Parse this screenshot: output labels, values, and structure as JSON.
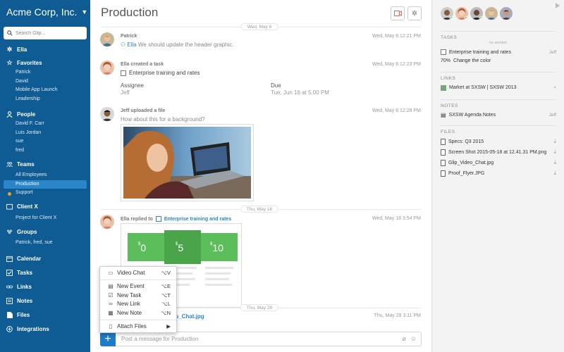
{
  "sidebar": {
    "org_name": "Acme Corp, Inc.",
    "search_placeholder": "Search Glip...",
    "ella": "Ella",
    "favorites": {
      "label": "Favorites",
      "items": [
        "Patrick",
        "David",
        "Mobile App Launch",
        "Leadership"
      ]
    },
    "people": {
      "label": "People",
      "items": [
        "David F. Carr",
        "Luis Jordan",
        "sue",
        "fred"
      ]
    },
    "teams": {
      "label": "Teams",
      "items": [
        "All Employees",
        "Production",
        "Support"
      ]
    },
    "client": {
      "label": "Client X",
      "items": [
        "Project for Client X"
      ]
    },
    "groups": {
      "label": "Groups",
      "items": [
        "Patrick, fred, sue"
      ]
    },
    "calendar": "Calendar",
    "tasks": "Tasks",
    "links": "Links",
    "notes": "Notes",
    "files": "Files",
    "integrations": "Integrations"
  },
  "main": {
    "title": "Production",
    "date_top": "Wed, May 6",
    "msg1": {
      "author": "Patrick",
      "time": "Wed, May 6 12:21 PM",
      "mention": "Ella",
      "text": "We should update the header graphic."
    },
    "msg2": {
      "header": "Ella created a task",
      "time": "Wed, May 6 12:23 PM",
      "task": "Enterprise training and rates",
      "assignee_label": "Assignee",
      "assignee": "Jeff",
      "due_label": "Due",
      "due": "Tue, Jun 16 at 5.00 PM"
    },
    "msg3": {
      "header": "Jeff uploaded a file",
      "time": "Wed, May 6 12:29 PM",
      "text": "How about this for a background?"
    },
    "date_mid": "Thu, May 18",
    "msg4": {
      "header": "Ella replied to",
      "task": "Enterprise training and rates",
      "time": "Wed, May 18 3:54 PM"
    },
    "pricing": {
      "p1": "0",
      "p2": "5",
      "p3": "10"
    },
    "date_low": "Thu, May 28",
    "msg5": {
      "file": "deo_Chat.jpg",
      "time": "Thu, May 28 3:11 PM"
    },
    "compose_placeholder": "Post a message for Production"
  },
  "menu": {
    "items": [
      {
        "label": "Video Chat",
        "shortcut": "⌥V"
      },
      {
        "label": "New Event",
        "shortcut": "⌥E"
      },
      {
        "label": "New Task",
        "shortcut": "⌥T"
      },
      {
        "label": "New Link",
        "shortcut": "⌥L"
      },
      {
        "label": "New Note",
        "shortcut": "⌥N"
      },
      {
        "label": "Attach Files",
        "shortcut": "▶"
      }
    ]
  },
  "rpanel": {
    "tasks_header": "TASKS",
    "no_section": "no section",
    "task1": "Enterprise training and rates",
    "task1_who": "Jeff",
    "task2_pct": "70%",
    "task2": "Change the color",
    "links_header": "LINKS",
    "link1": "Market at SXSW | SXSW 2013",
    "notes_header": "NOTES",
    "note1": "SXSW Agenda Notes",
    "note1_who": "Jeff",
    "files_header": "FILES",
    "files": [
      "Specs: Q3 2015",
      "Screen Shot 2015-05-18 at 12.41.31 PM.png",
      "Glip_Video_Chat.jpg",
      "Proof_Flyer.JPG"
    ]
  },
  "colors": {
    "sidebar": "#0e5c93",
    "active": "#2a86c8",
    "accent": "#1d7cc4",
    "pricing_green": "#5cbd5b"
  }
}
